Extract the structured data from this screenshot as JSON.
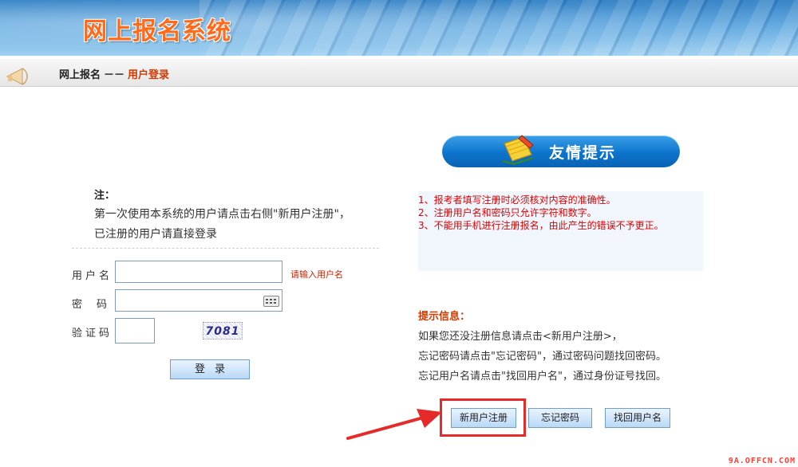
{
  "header": {
    "title": "网上报名系统"
  },
  "breadcrumb": {
    "root": "网上报名",
    "separator": "－－",
    "current": "用户登录"
  },
  "notice": {
    "title": "注：",
    "line1": "第一次使用本系统的用户请点击右侧\"新用户注册\"，",
    "line2": "已注册的用户请直接登录"
  },
  "login_form": {
    "username_label": "用户名",
    "username_value": "",
    "username_hint": "请输入用户名",
    "password_label": "密码",
    "password_value": "",
    "captcha_label": "验证码",
    "captcha_value": "",
    "captcha_code": "7081",
    "login_button": "登录"
  },
  "tips_panel": {
    "title": "友情提示",
    "items": [
      "1、报考者填写注册时必须核对内容的准确性。",
      "2、注册用户名和密码只允许字符和数字。",
      "3、不能用手机进行注册报名，由此产生的错误不予更正。"
    ]
  },
  "info": {
    "title": "提示信息：",
    "lines": [
      "如果您还没注册信息请点击<新用户注册>，",
      "忘记密码请点击\"忘记密码\"，通过密码问题找回密码。",
      "忘记用户名请点击\"找回用户名\"，通过身份证号找回。"
    ]
  },
  "buttons": {
    "register": "新用户注册",
    "forgot_password": "忘记密码",
    "find_username": "找回用户名"
  },
  "watermark": "9A.OFFCN.COM",
  "colors": {
    "accent_orange": "#ff6a1a",
    "tip_red": "#e00000",
    "highlight_red": "#e52a2a",
    "pill_blue": "#0c74cc"
  }
}
